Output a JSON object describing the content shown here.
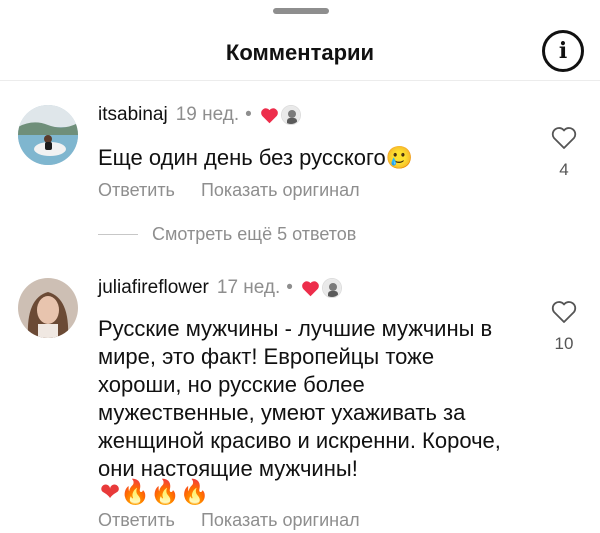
{
  "header": {
    "title": "Комментарии",
    "info_icon": "i"
  },
  "comments": [
    {
      "username": "itsabinaj",
      "time": "19 нед.",
      "separator": "•",
      "text": "Еще один день без русского",
      "text_emoji": "🥲",
      "reply_label": "Ответить",
      "translate_label": "Показать оригинал",
      "like_count": "4"
    },
    {
      "username": "juliafireflower",
      "time": "17 нед.",
      "separator": "•",
      "lines": [
        "Русские мужчины - лучшие мужчины в",
        "мире, это факт! Европейцы тоже",
        "хороши, но русские более",
        "мужественные, умеют ухаживать за",
        "женщиной красиво и искренни. Короче,",
        "они настоящие мужчины!"
      ],
      "emoji_line": "❤🔥🔥🔥",
      "reply_label": "Ответить",
      "translate_label": "Показать оригинал",
      "like_count": "10"
    }
  ],
  "more_replies": "Смотреть ещё 5 ответов",
  "colors": {
    "heart_red": "#ed2d4b",
    "secondary_text": "#8e8e8e"
  }
}
